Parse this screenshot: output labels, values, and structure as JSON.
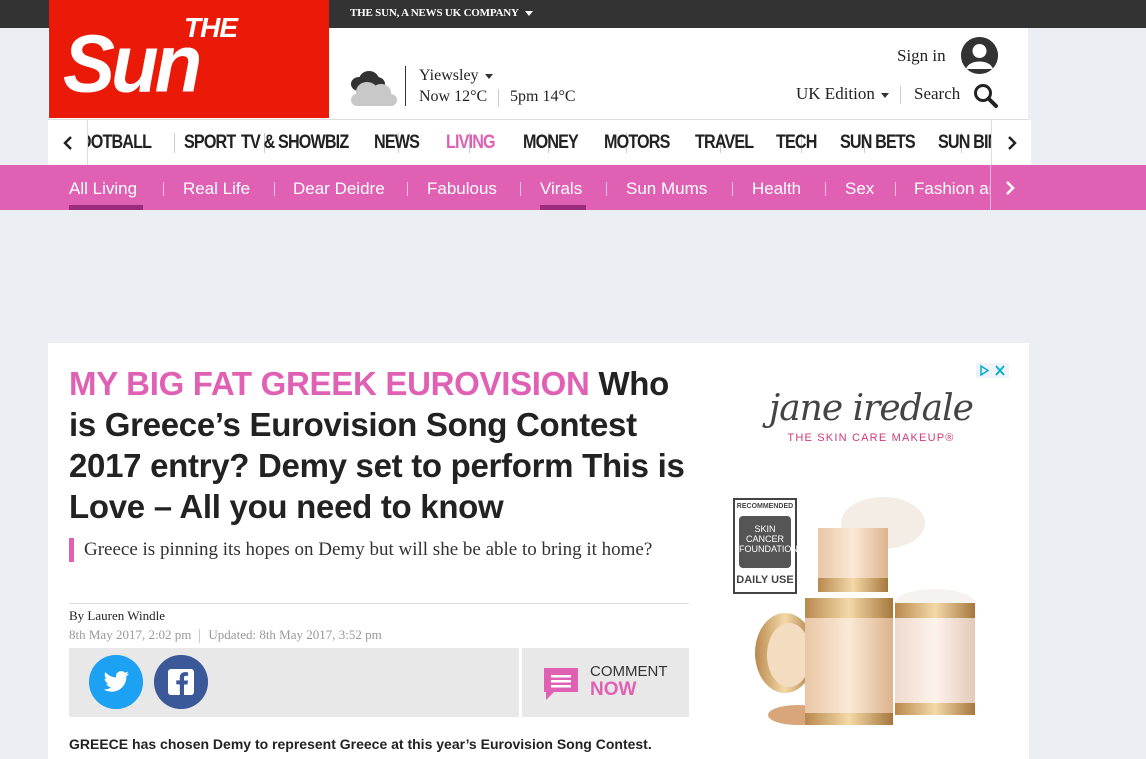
{
  "topbar": {
    "company": "THE SUN, A NEWS UK COMPANY"
  },
  "logo": {
    "the": "THE",
    "sun": "Sun"
  },
  "weather": {
    "location": "Yiewsley",
    "now": "Now 12°C",
    "later": "5pm 14°C",
    "icon": "cloudy-weather-icon"
  },
  "account": {
    "signin": "Sign in",
    "edition": "UK Edition",
    "search": "Search"
  },
  "nav": {
    "items": [
      {
        "label": "FOOTBALL",
        "active": false
      },
      {
        "label": "SPORT",
        "active": false
      },
      {
        "label": "TV & SHOWBIZ",
        "active": false
      },
      {
        "label": "NEWS",
        "active": false
      },
      {
        "label": "LIVING",
        "active": true
      },
      {
        "label": "MONEY",
        "active": false
      },
      {
        "label": "MOTORS",
        "active": false
      },
      {
        "label": "TRAVEL",
        "active": false
      },
      {
        "label": "TECH",
        "active": false
      },
      {
        "label": "SUN BETS",
        "active": false
      },
      {
        "label": "SUN BINGO",
        "active": false
      }
    ],
    "active_color": "#e061b4"
  },
  "subnav": {
    "items": [
      {
        "label": "All Living",
        "active": true
      },
      {
        "label": "Real Life",
        "active": false
      },
      {
        "label": "Dear Deidre",
        "active": false
      },
      {
        "label": "Fabulous",
        "active": false
      },
      {
        "label": "Virals",
        "active": true
      },
      {
        "label": "Sun Mums",
        "active": false
      },
      {
        "label": "Health",
        "active": false
      },
      {
        "label": "Sex",
        "active": false
      },
      {
        "label": "Fashion and Beauty",
        "active": false
      }
    ],
    "bg_color": "#e061b4"
  },
  "article": {
    "kicker": "MY BIG FAT GREEK EUROVISION",
    "headline": "Who is Greece’s Eurovision Song Contest 2017 entry? Demy set to perform This is Love – All you need to know",
    "standfirst": "Greece is pinning its hopes on Demy but will she be able to bring it home?",
    "byline": "By Lauren Windle",
    "published": "8th May 2017, 2:02 pm",
    "updated": "Updated: 8th May 2017, 3:52 pm",
    "comment_label": "COMMENT",
    "comment_now": "NOW",
    "body_first": "GREECE has chosen Demy to represent Greece at this year’s Eurovision Song Contest."
  },
  "advert": {
    "brand": "jane iredale",
    "tagline": "THE SKIN CARE MAKEUP®",
    "badge_top": "RECOMMENDED",
    "badge_mid": "SKIN CANCER FOUNDATION",
    "badge_bottom": "DAILY USE"
  }
}
